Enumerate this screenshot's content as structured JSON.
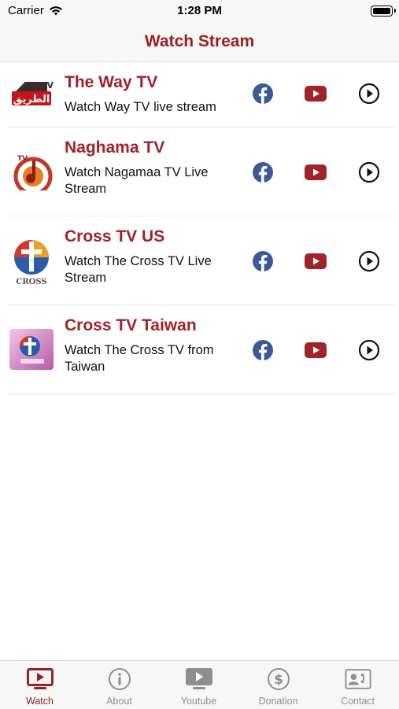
{
  "status_bar": {
    "carrier": "Carrier",
    "time": "1:28 PM"
  },
  "nav": {
    "title": "Watch Stream"
  },
  "channels": [
    {
      "title": "The Way TV",
      "description": "Watch Way TV live stream",
      "logo_text": "الطريق",
      "logo_badge": "TV"
    },
    {
      "title": "Naghama TV",
      "description": "Watch Nagamaa TV Live Stream",
      "logo_badge": "TV"
    },
    {
      "title": "Cross TV US",
      "description": "Watch The Cross TV Live Stream",
      "logo_text": "CROSS"
    },
    {
      "title": "Cross TV Taiwan",
      "description": "Watch The Cross TV from Taiwan"
    }
  ],
  "actions": {
    "facebook_icon": "facebook-icon",
    "youtube_icon": "youtube-icon",
    "play_icon": "play-circle-icon"
  },
  "tabs": [
    {
      "label": "Watch",
      "icon": "tv-play-icon",
      "active": true
    },
    {
      "label": "About",
      "icon": "info-icon"
    },
    {
      "label": "Youtube",
      "icon": "video-play-icon"
    },
    {
      "label": "Donation",
      "icon": "dollar-icon"
    },
    {
      "label": "Contact",
      "icon": "contact-card-icon"
    }
  ],
  "colors": {
    "accent": "#9b2020",
    "facebook": "#3b5998",
    "youtube": "#a0232a",
    "inactive": "#8e8e8e"
  }
}
